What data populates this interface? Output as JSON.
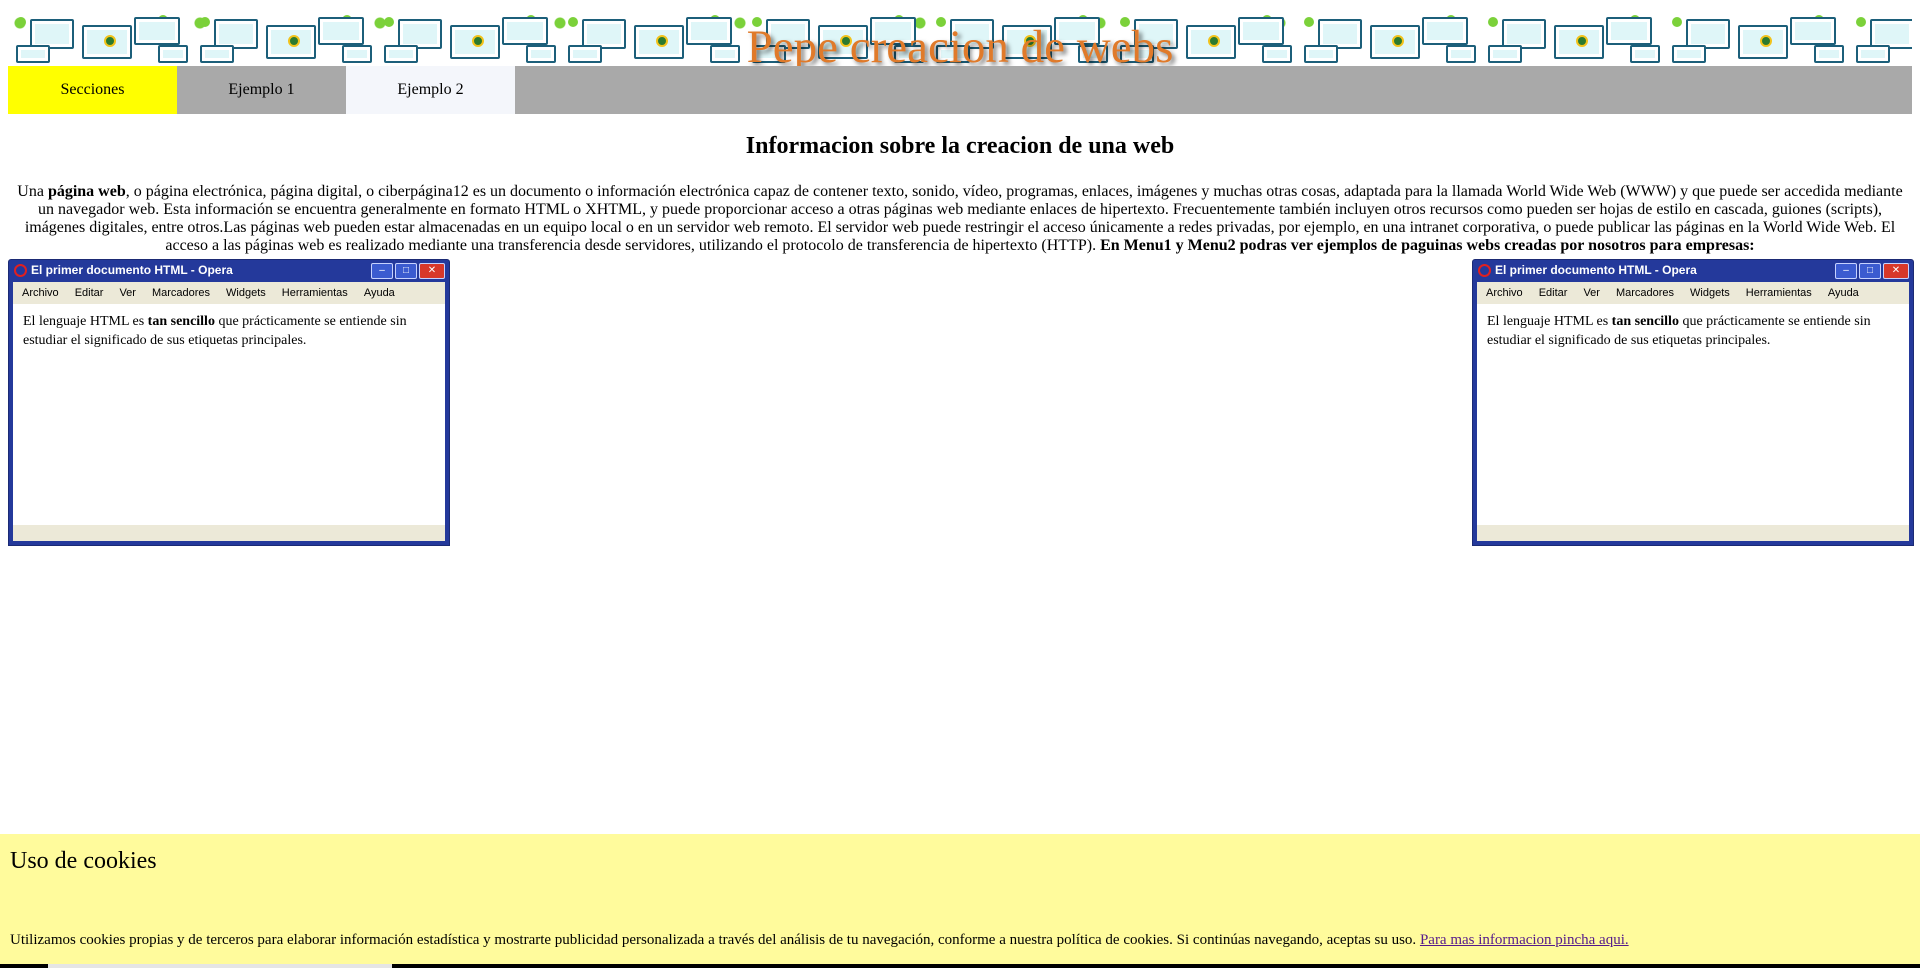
{
  "header": {
    "site_title": "Pepe creacion de webs"
  },
  "nav": {
    "items": [
      "Secciones",
      "Ejemplo 1",
      "Ejemplo 2"
    ]
  },
  "main": {
    "heading": "Informacion sobre la creacion de una web",
    "intro_p1": "Una ",
    "intro_b1": "página web",
    "intro_p2": ", o página electrónica, página digital, o ciberpágina12 es un documento o información electrónica capaz de contener texto, sonido, vídeo, programas, enlaces, imágenes y muchas otras cosas, adaptada para la llamada World Wide Web (WWW) y que puede ser accedida mediante un navegador web. Esta información se encuentra generalmente en formato HTML o XHTML, y puede proporcionar acceso a otras páginas web mediante enlaces de hipertexto. Frecuentemente también incluyen otros recursos como pueden ser hojas de estilo en cascada, guiones (scripts), imágenes digitales, entre otros.Las páginas web pueden estar almacenadas en un equipo local o en un servidor web remoto. El servidor web puede restringir el acceso únicamente a redes privadas, por ejemplo, en una intranet corporativa, o puede publicar las páginas en la World Wide Web. El acceso a las páginas web es realizado mediante una transferencia desde servidores, utilizando el protocolo de transferencia de hipertexto (HTTP). ",
    "intro_b2": "En Menu1 y Menu2 podras ver ejemplos de paguinas webs creadas por nosotros para empresas:"
  },
  "opera_window": {
    "title": "El primer documento HTML - Opera",
    "menu": [
      "Archivo",
      "Editar",
      "Ver",
      "Marcadores",
      "Widgets",
      "Herramientas",
      "Ayuda"
    ],
    "content_p1": "El lenguaje HTML es ",
    "content_b": "tan sencillo",
    "content_p2": " que prácticamente se entiende sin estudiar el significado de sus etiquetas principales."
  },
  "cookies": {
    "title": "Uso de cookies",
    "text": "Utilizamos cookies propias y de terceros para elaborar información estadística y mostrarte publicidad personalizada a través del análisis de tu navegación, conforme a nuestra política de cookies. Si continúas navegando, aceptas su uso. ",
    "link": "Para mas informacion pincha aqui."
  },
  "colors": {
    "banner_bg": "#12b3c4",
    "title_color": "#e07a2a",
    "nav_active": "#ffff00",
    "nav_bg": "#a9a9a9",
    "cookie_bg": "#fffb9c",
    "opera_frame": "#24399b"
  }
}
